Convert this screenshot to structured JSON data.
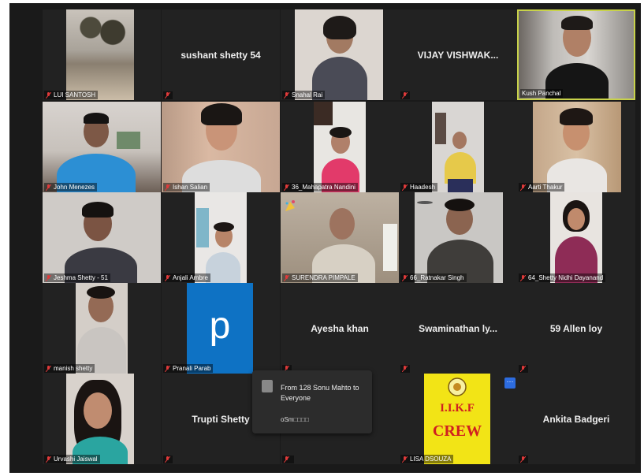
{
  "participants": [
    {
      "name": "LUI SANTOSH"
    },
    {
      "name": "sushant shetty 54"
    },
    {
      "name": "Snahal Rai"
    },
    {
      "name": "VIJAY  VISHWAK..."
    },
    {
      "name": "Kush Panchal"
    },
    {
      "name": "John Menezes"
    },
    {
      "name": "Ishan Salian"
    },
    {
      "name": "36_Mahapatra Nandini"
    },
    {
      "name": "Haadesh"
    },
    {
      "name": "Aarti Thakur"
    },
    {
      "name": "Jeshma Shetty - 51"
    },
    {
      "name": "Anjali Ambre"
    },
    {
      "name": "SURENDRA PIMPALE"
    },
    {
      "name": "66_Ratnakar Singh"
    },
    {
      "name": "64_Shetty Nidhi Dayanand"
    },
    {
      "name": "manish shetty"
    },
    {
      "name": "Pranali Parab",
      "avatar_letter": "p"
    },
    {
      "name": "Ayesha khan"
    },
    {
      "name": "Swaminathan  ly..."
    },
    {
      "name": "59 Allen loy"
    },
    {
      "name": "Urvashi Jaiswal"
    },
    {
      "name": "Trupti Shetty"
    },
    {
      "name": ""
    },
    {
      "name": "LISA DSOUZA",
      "logo_lines": [
        "I.I.K.F",
        "CREW"
      ]
    },
    {
      "name": "Ankita Badgeri"
    }
  ],
  "chat_popup": {
    "from": "From 128 Sonu Mahto to Everyone",
    "message": "oSm□□□□"
  },
  "more_button": "···",
  "colors": {
    "active_speaker": "#c8d24a",
    "muted_mic": "#e03a3a",
    "tile_bg": "#222222",
    "avatar_blue": "#0e72c4"
  }
}
